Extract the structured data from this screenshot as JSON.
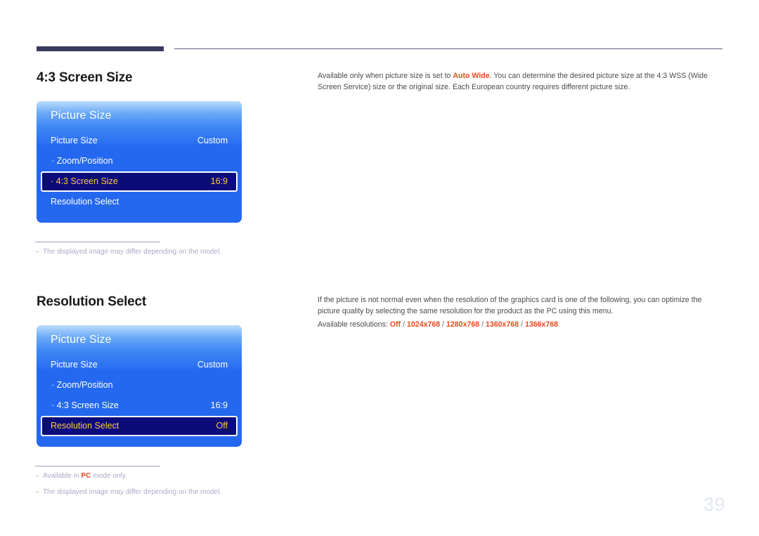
{
  "page": {
    "number": "39"
  },
  "sections": [
    {
      "heading": "4:3 Screen Size",
      "osd": {
        "title": "Picture Size",
        "rows": [
          {
            "label": "Picture Size",
            "value": "Custom",
            "sub": false,
            "selected": false
          },
          {
            "label": "· Zoom/Position",
            "value": "",
            "sub": true,
            "selected": false
          },
          {
            "label": "· 4:3 Screen Size",
            "value": "16:9",
            "sub": true,
            "selected": true
          },
          {
            "label": "Resolution Select",
            "value": "",
            "sub": false,
            "selected": false
          }
        ]
      },
      "copy": {
        "lead": "Available only when picture size is set to ",
        "accent": "Auto Wide",
        "tail": ". You can determine the desired picture size at the 4:3 WSS (Wide Screen Service) size or the original size. Each European country requires different picture size."
      },
      "notes": [
        {
          "dash": "‒",
          "text_before": "The displayed image may differ depending on the model.",
          "accent": "",
          "text_after": ""
        }
      ]
    },
    {
      "heading": "Resolution Select",
      "osd": {
        "title": "Picture Size",
        "rows": [
          {
            "label": "Picture Size",
            "value": "Custom",
            "sub": false,
            "selected": false
          },
          {
            "label": "· Zoom/Position",
            "value": "",
            "sub": true,
            "selected": false
          },
          {
            "label": "· 4:3 Screen Size",
            "value": "16:9",
            "sub": true,
            "selected": false
          },
          {
            "label": "Resolution Select",
            "value": "Off",
            "sub": false,
            "selected": true
          }
        ]
      },
      "copy": {
        "lead": "If the picture is not normal even when the resolution of the graphics card is one of the following, you can optimize the picture quality by selecting the same resolution for the product as the PC using this menu.",
        "accent": "",
        "tail": ""
      },
      "available": {
        "label": "Available resolutions: ",
        "items": [
          "Off",
          "1024x768",
          "1280x768",
          "1360x768",
          "1366x768"
        ],
        "separator": " / "
      },
      "notes": [
        {
          "dash": "‒",
          "text_before": "Available in ",
          "accent": "PC",
          "text_after": " mode only."
        },
        {
          "dash": "‒",
          "text_before": "The displayed image may differ depending on the model.",
          "accent": "",
          "text_after": ""
        }
      ]
    }
  ],
  "colors": {
    "accent_red": "#e8491f",
    "osd_blue": "#2468f0",
    "osd_selected_bg": "#0b0b7a",
    "osd_selected_text": "#ffcc33",
    "rule_navy": "#373a5c",
    "note_gray": "#a8aac6"
  }
}
